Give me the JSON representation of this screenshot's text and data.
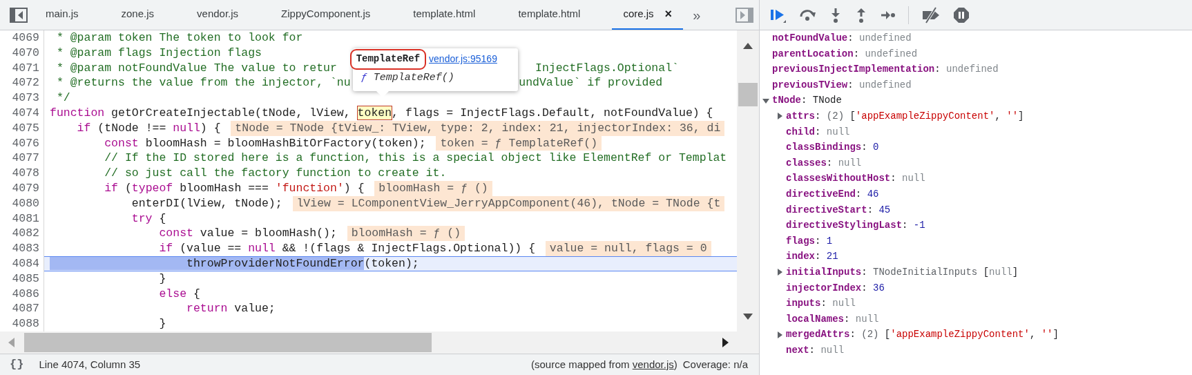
{
  "tabs": [
    {
      "label": "main.js",
      "selected": false
    },
    {
      "label": "zone.js",
      "selected": false
    },
    {
      "label": "vendor.js",
      "selected": false
    },
    {
      "label": "ZippyComponent.js",
      "selected": false
    },
    {
      "label": "template.html",
      "selected": false
    },
    {
      "label": "template.html",
      "selected": false
    },
    {
      "label": "core.js",
      "selected": true,
      "close": "×"
    }
  ],
  "tab_overflow": "»",
  "code": {
    "lines": [
      {
        "number": "4069",
        "paused": false,
        "segments": [
          {
            "kind": "comment",
            "text": " * @param token The token to look for"
          }
        ]
      },
      {
        "number": "4070",
        "paused": false,
        "segments": [
          {
            "kind": "comment",
            "text": " * @param flags Injection flags"
          }
        ]
      },
      {
        "number": "4071",
        "paused": false,
        "segments": [
          {
            "kind": "comment",
            "text": " * @param notFoundValue The value to retur"
          },
          {
            "kind": "comment",
            "text": "InjectFlags.Optional`",
            "after_popover": true
          }
        ]
      },
      {
        "number": "4072",
        "paused": false,
        "segments": [
          {
            "kind": "comment",
            "text": " * @returns the value from the injector, `nu"
          },
          {
            "kind": "comment",
            "text": "undValue` if provided",
            "after_popover": true
          }
        ]
      },
      {
        "number": "4073",
        "paused": false,
        "segments": [
          {
            "kind": "comment",
            "text": " */"
          }
        ]
      },
      {
        "number": "4074",
        "paused": false,
        "segments": [
          {
            "kind": "keyword",
            "text": "function"
          },
          {
            "kind": "plain",
            "text": " getOrCreateInjectable(tNode, lView, "
          },
          {
            "kind": "hover",
            "text": "token"
          },
          {
            "kind": "plain",
            "text": ", flags = InjectFlags.Default, notFoundValue) {"
          }
        ]
      },
      {
        "number": "4075",
        "paused": false,
        "segments": [
          {
            "kind": "keyword",
            "text": "    if"
          },
          {
            "kind": "plain",
            "text": " (tNode !== "
          },
          {
            "kind": "keyword",
            "text": "null"
          },
          {
            "kind": "plain",
            "text": ") {"
          }
        ],
        "inline_value": "tNode = TNode {tView_: TView, type: 2, index: 21, injectorIndex: 36, di"
      },
      {
        "number": "4076",
        "paused": false,
        "segments": [
          {
            "kind": "keyword",
            "text": "        const"
          },
          {
            "kind": "plain",
            "text": " bloomHash = bloomHashBitOrFactory(token);"
          }
        ],
        "inline_value": "token = ƒ TemplateRef()"
      },
      {
        "number": "4077",
        "paused": false,
        "segments": [
          {
            "kind": "comment",
            "text": "        // If the ID stored here is a function, this is a special object like ElementRef or Templat"
          }
        ]
      },
      {
        "number": "4078",
        "paused": false,
        "segments": [
          {
            "kind": "comment",
            "text": "        // so just call the factory function to create it."
          }
        ]
      },
      {
        "number": "4079",
        "paused": false,
        "segments": [
          {
            "kind": "keyword",
            "text": "        if"
          },
          {
            "kind": "plain",
            "text": " ("
          },
          {
            "kind": "keyword",
            "text": "typeof"
          },
          {
            "kind": "plain",
            "text": " bloomHash === "
          },
          {
            "kind": "string",
            "text": "'function'"
          },
          {
            "kind": "plain",
            "text": ") {"
          }
        ],
        "inline_value": "bloomHash = ƒ ()"
      },
      {
        "number": "4080",
        "paused": false,
        "segments": [
          {
            "kind": "plain",
            "text": "            enterDI(lView, tNode);"
          }
        ],
        "inline_value": "lView = LComponentView_JerryAppComponent(46), tNode = TNode {t"
      },
      {
        "number": "4081",
        "paused": false,
        "segments": [
          {
            "kind": "keyword",
            "text": "            try"
          },
          {
            "kind": "plain",
            "text": " {"
          }
        ]
      },
      {
        "number": "4082",
        "paused": false,
        "segments": [
          {
            "kind": "keyword",
            "text": "                const"
          },
          {
            "kind": "plain",
            "text": " value = bloomHash();"
          }
        ],
        "inline_value": "bloomHash = ƒ ()"
      },
      {
        "number": "4083",
        "paused": false,
        "segments": [
          {
            "kind": "keyword",
            "text": "                if"
          },
          {
            "kind": "plain",
            "text": " (value == "
          },
          {
            "kind": "keyword",
            "text": "null"
          },
          {
            "kind": "plain",
            "text": " && !(flags & InjectFlags.Optional)) {"
          }
        ],
        "inline_value": "value = null, flags = 0"
      },
      {
        "number": "4084",
        "paused": true,
        "segments": [
          {
            "kind": "execution",
            "text": "                    throwProviderNotFoundError"
          },
          {
            "kind": "plain",
            "text": "(token);"
          }
        ]
      },
      {
        "number": "4085",
        "paused": false,
        "segments": [
          {
            "kind": "plain",
            "text": "                }"
          }
        ]
      },
      {
        "number": "4086",
        "paused": false,
        "segments": [
          {
            "kind": "keyword",
            "text": "                else"
          },
          {
            "kind": "plain",
            "text": " {"
          }
        ]
      },
      {
        "number": "4087",
        "paused": false,
        "segments": [
          {
            "kind": "keyword",
            "text": "                    return"
          },
          {
            "kind": "plain",
            "text": " value;"
          }
        ]
      },
      {
        "number": "4088",
        "paused": false,
        "segments": [
          {
            "kind": "plain",
            "text": "                }"
          }
        ]
      }
    ]
  },
  "popover": {
    "title": "TemplateRef",
    "link": "vendor.js:95169",
    "signature_mark": "ƒ",
    "signature": "TemplateRef()"
  },
  "scope": [
    {
      "key": "notFoundValue",
      "separator": ":",
      "expandable": false,
      "value": [
        {
          "kind": "undefined",
          "text": "undefined"
        }
      ]
    },
    {
      "key": "parentLocation",
      "separator": ":",
      "expandable": false,
      "value": [
        {
          "kind": "undefined",
          "text": "undefined"
        }
      ]
    },
    {
      "key": "previousInjectImplementation",
      "separator": ":",
      "expandable": false,
      "value": [
        {
          "kind": "undefined",
          "text": "undefined"
        }
      ]
    },
    {
      "key": "previousTView",
      "separator": ":",
      "expandable": false,
      "value": [
        {
          "kind": "undefined",
          "text": "undefined"
        }
      ]
    },
    {
      "key": "tNode",
      "separator": ":",
      "expandable": true,
      "expanded": true,
      "value": [
        {
          "kind": "plain",
          "text": "TNode"
        }
      ],
      "children": [
        {
          "key": "attrs",
          "separator": ":",
          "expandable": true,
          "expanded": false,
          "value": [
            {
              "kind": "meta",
              "text": "(2) "
            },
            {
              "kind": "plain",
              "text": "["
            },
            {
              "kind": "string",
              "text": "'appExampleZippyContent'"
            },
            {
              "kind": "plain",
              "text": ", "
            },
            {
              "kind": "string",
              "text": "''"
            },
            {
              "kind": "plain",
              "text": "]"
            }
          ]
        },
        {
          "key": "child",
          "separator": ":",
          "expandable": false,
          "value": [
            {
              "kind": "null",
              "text": "null"
            }
          ]
        },
        {
          "key": "classBindings",
          "separator": ":",
          "expandable": false,
          "value": [
            {
              "kind": "number",
              "text": "0"
            }
          ]
        },
        {
          "key": "classes",
          "separator": ":",
          "expandable": false,
          "value": [
            {
              "kind": "null",
              "text": "null"
            }
          ]
        },
        {
          "key": "classesWithoutHost",
          "separator": ":",
          "expandable": false,
          "value": [
            {
              "kind": "null",
              "text": "null"
            }
          ]
        },
        {
          "key": "directiveEnd",
          "separator": ":",
          "expandable": false,
          "value": [
            {
              "kind": "number",
              "text": "46"
            }
          ]
        },
        {
          "key": "directiveStart",
          "separator": ":",
          "expandable": false,
          "value": [
            {
              "kind": "number",
              "text": "45"
            }
          ]
        },
        {
          "key": "directiveStylingLast",
          "separator": ":",
          "expandable": false,
          "value": [
            {
              "kind": "number",
              "text": "-1"
            }
          ]
        },
        {
          "key": "flags",
          "separator": ":",
          "expandable": false,
          "value": [
            {
              "kind": "number",
              "text": "1"
            }
          ]
        },
        {
          "key": "index",
          "separator": ":",
          "expandable": false,
          "value": [
            {
              "kind": "number",
              "text": "21"
            }
          ]
        },
        {
          "key": "initialInputs",
          "separator": ":",
          "expandable": true,
          "expanded": false,
          "value": [
            {
              "kind": "meta",
              "text": "TNodeInitialInputs "
            },
            {
              "kind": "plain",
              "text": "["
            },
            {
              "kind": "null",
              "text": "null"
            },
            {
              "kind": "plain",
              "text": "]"
            }
          ]
        },
        {
          "key": "injectorIndex",
          "separator": ":",
          "expandable": false,
          "value": [
            {
              "kind": "number",
              "text": "36"
            }
          ]
        },
        {
          "key": "inputs",
          "separator": ":",
          "expandable": false,
          "value": [
            {
              "kind": "null",
              "text": "null"
            }
          ]
        },
        {
          "key": "localNames",
          "separator": ":",
          "expandable": false,
          "value": [
            {
              "kind": "null",
              "text": "null"
            }
          ]
        },
        {
          "key": "mergedAttrs",
          "separator": ":",
          "expandable": true,
          "expanded": false,
          "value": [
            {
              "kind": "meta",
              "text": "(2) "
            },
            {
              "kind": "plain",
              "text": "["
            },
            {
              "kind": "string",
              "text": "'appExampleZippyContent'"
            },
            {
              "kind": "plain",
              "text": ", "
            },
            {
              "kind": "string",
              "text": "''"
            },
            {
              "kind": "plain",
              "text": "]"
            }
          ]
        },
        {
          "key": "next",
          "separator": ":",
          "expandable": false,
          "value": [
            {
              "kind": "null",
              "text": "null"
            }
          ]
        }
      ]
    }
  ],
  "status_bar": {
    "format_mark": "{}",
    "position": "Line 4074, Column 35",
    "source_prefix": "(source mapped from ",
    "source_link": "vendor.js",
    "source_suffix": ")",
    "coverage": "Coverage: n/a"
  }
}
